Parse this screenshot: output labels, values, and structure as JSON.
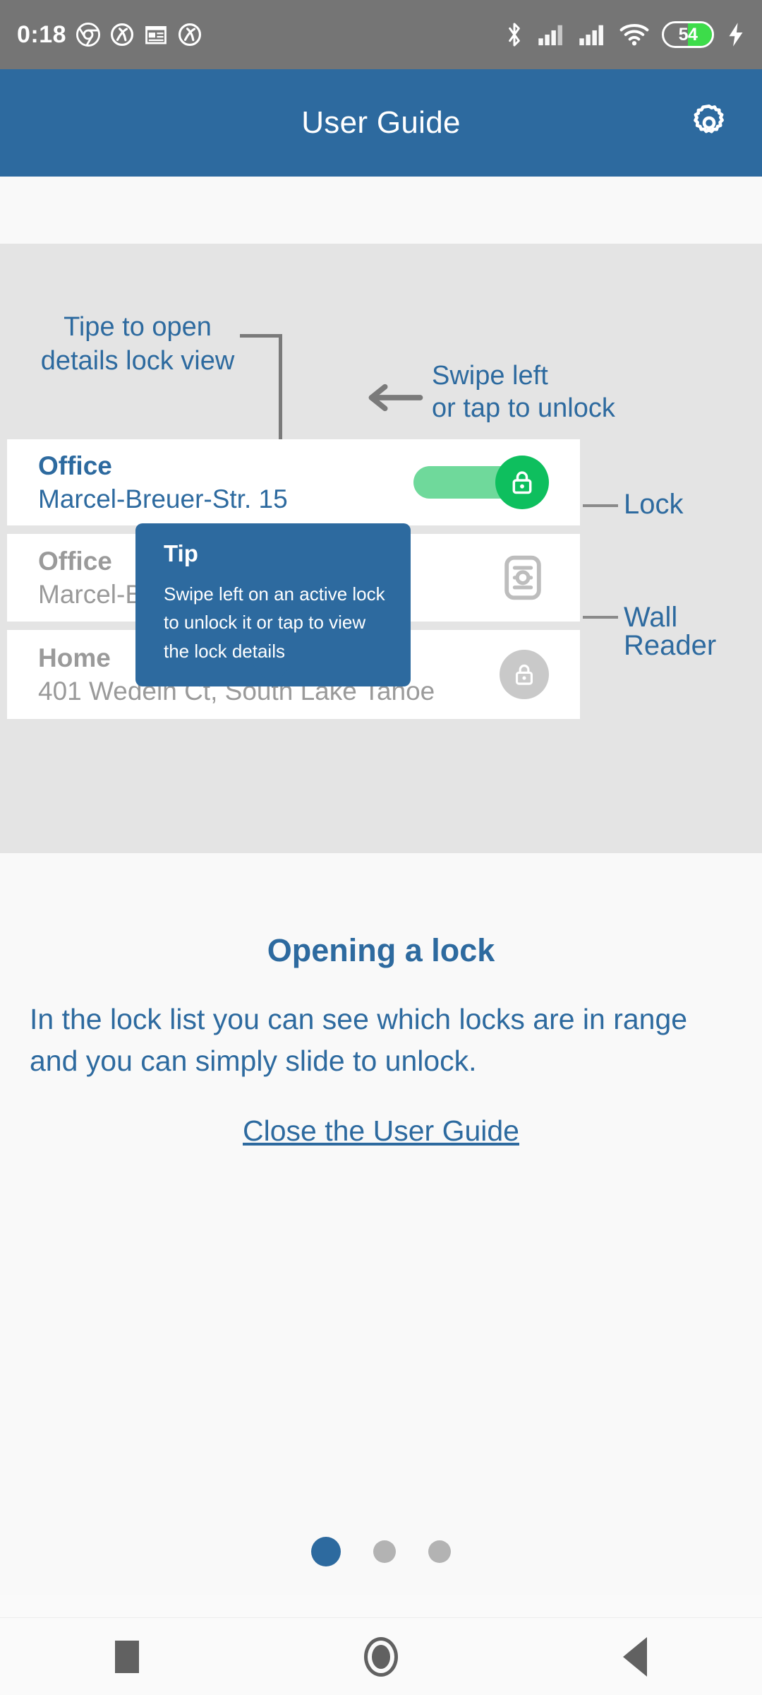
{
  "statusbar": {
    "clock": "0:18",
    "left_icons": [
      "chrome-icon",
      "adblock-icon",
      "news-icon",
      "adblock-icon"
    ],
    "right_icons": [
      "bluetooth-icon",
      "signal-icon",
      "signal-icon",
      "wifi-icon",
      "battery-icon",
      "charging-bolt-icon"
    ],
    "battery_level": "54"
  },
  "appbar": {
    "title": "User Guide",
    "settings_icon": "gear-icon",
    "color": "#2D6A9F"
  },
  "illustration": {
    "annotations": {
      "tap_detail": "Tipe to open\ndetails lock view",
      "tap_detail_line1": "Tipe to open",
      "tap_detail_line2": "details lock view",
      "swipe_line1": "Swipe left",
      "swipe_line2": "or tap to unlock",
      "arrow_icon": "arrow-left-icon"
    },
    "side_labels": {
      "lock": "Lock",
      "wall_reader": "Wall Reader"
    },
    "cards": [
      {
        "title": "Office",
        "address": "Marcel-Breuer-Str. 15",
        "state": "active",
        "control": "unlock-slider",
        "control_icon": "lock-icon"
      },
      {
        "title": "Office",
        "address": "Marcel-Breuer-Str. 15",
        "state": "idle",
        "control": "wall-reader-icon",
        "control_icon": "wall-reader-icon"
      },
      {
        "title": "Home",
        "address": "401 Wedeln Ct, South Lake Tahoe",
        "state": "idle",
        "control": "locked-icon",
        "control_icon": "lock-icon"
      }
    ],
    "tip": {
      "title": "Tip",
      "body": "Swipe left on an active lock to unlock it or tap to view the lock details"
    }
  },
  "lower": {
    "heading": "Opening a lock",
    "body": "In the lock list you can see which locks are in range and you can simply slide to unlock.",
    "close_link": "Close the User Guide"
  },
  "pager": {
    "total": "3",
    "current": "1"
  },
  "navbar": {
    "recents": "recents-square-icon",
    "home": "home-circle-icon",
    "back": "back-triangle-icon"
  },
  "colors": {
    "accent": "#2D6A9F",
    "unlock_green": "#0EBF5E",
    "track_green": "#6FD99B",
    "idle_gray": "#9A9A9A",
    "panel_gray": "#E4E4E4"
  }
}
